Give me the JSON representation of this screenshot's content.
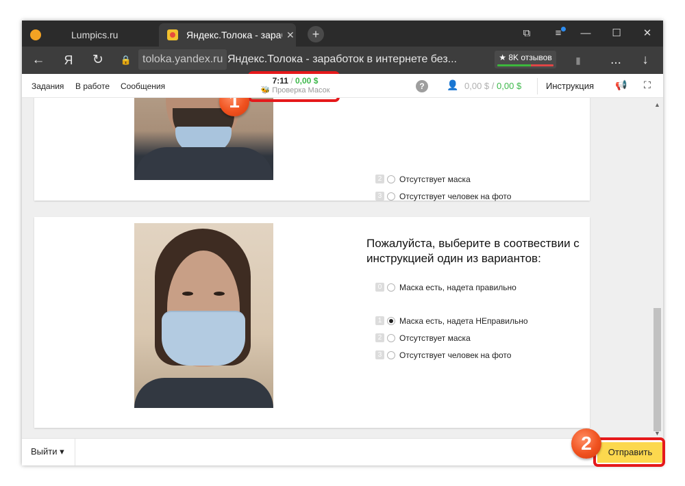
{
  "browser": {
    "tabs": [
      {
        "title": "Lumpics.ru"
      },
      {
        "title": "Яндекс.Толока - зарабо",
        "close": "✕"
      }
    ],
    "new_tab": "+",
    "controls": {
      "minimize": "—",
      "maximize": "☐",
      "close": "✕"
    },
    "address": {
      "back": "←",
      "yandex": "Я",
      "reload": "↻",
      "host": "toloka.yandex.ru",
      "page_title": "Яндекс.Толока - заработок в интернете без...",
      "reviews": "★ 8K отзывов",
      "more": "...",
      "download": "↓"
    }
  },
  "toolbar": {
    "nav": {
      "tasks": "Задания",
      "in_work": "В работе",
      "messages": "Сообщения"
    },
    "timer": {
      "time": "7:11",
      "slash": "/",
      "money": "0,00 $",
      "project": "🐝 Проверка Масок"
    },
    "help": "?",
    "balance": {
      "pending": "0,00 $",
      "separator": "/",
      "available": "0,00 $"
    },
    "instruction": "Инструкция"
  },
  "tasks": [
    {
      "question": "",
      "options": [
        {
          "key": "2",
          "label": "Отсутствует маска",
          "checked": false
        },
        {
          "key": "3",
          "label": "Отсутствует человек на фото",
          "checked": false
        }
      ]
    },
    {
      "question": "Пожалуйста, выберите в соотвествии с инструкцией один из вариантов:",
      "options": [
        {
          "key": "0",
          "label": "Маска есть, надета правильно",
          "checked": false
        },
        {
          "key": "1",
          "label": "Маска есть, надета НЕправильно",
          "checked": true
        },
        {
          "key": "2",
          "label": "Отсутствует маска",
          "checked": false
        },
        {
          "key": "3",
          "label": "Отсутствует человек на фото",
          "checked": false
        }
      ]
    }
  ],
  "bottom": {
    "exit": "Выйти ▾",
    "submit": "Отправить"
  },
  "annotations": {
    "step1": "1",
    "step2": "2"
  },
  "colors": {
    "accent_yellow": "#fcd84e",
    "money_green": "#3cb84a",
    "annotation_red": "#e5191b"
  }
}
